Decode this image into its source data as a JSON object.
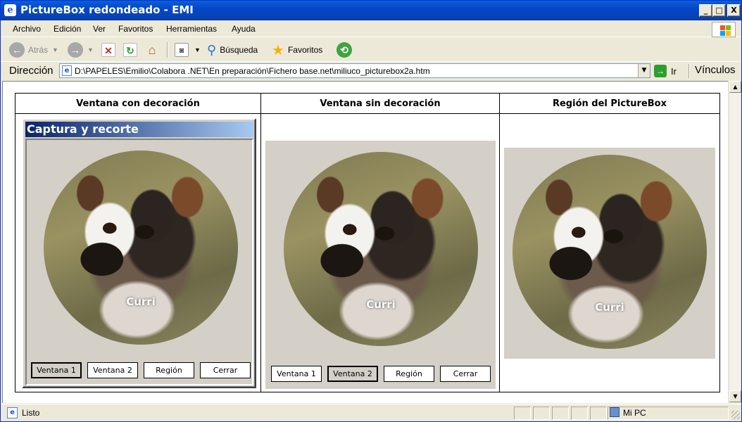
{
  "window": {
    "title": "PictureBox redondeado - EMI",
    "min": "_",
    "max": "□",
    "close": "X"
  },
  "menu": [
    "Archivo",
    "Edición",
    "Ver",
    "Favoritos",
    "Herramientas",
    "Ayuda"
  ],
  "toolbar": {
    "back": "Atrás",
    "search": "Búsqueda",
    "favorites": "Favoritos"
  },
  "address": {
    "label": "Dirección",
    "url": "D:\\PAPELES\\Emilio\\Colabora .NET\\En preparación\\Fichero base.net\\miliuco_picturebox2a.htm",
    "go": "Ir",
    "links": "Vínculos"
  },
  "table": {
    "headers": [
      "Ventana con decoración",
      "Ventana sin decoración",
      "Región del PictureBox"
    ]
  },
  "panel1": {
    "window_title": "Captura y recorte",
    "dog_caption": "Curri"
  },
  "panel2": {
    "dog_caption": "Curri"
  },
  "panel3": {
    "dog_caption": "Curri"
  },
  "buttons": [
    "Ventana 1",
    "Ventana 2",
    "Región",
    "Cerrar"
  ],
  "status": {
    "text": "Listo",
    "zone": "Mi PC"
  },
  "colors": {
    "title_bar": "#0A5FD6",
    "chrome": "#ECE9D8",
    "form_back": "#D4D0C8"
  }
}
